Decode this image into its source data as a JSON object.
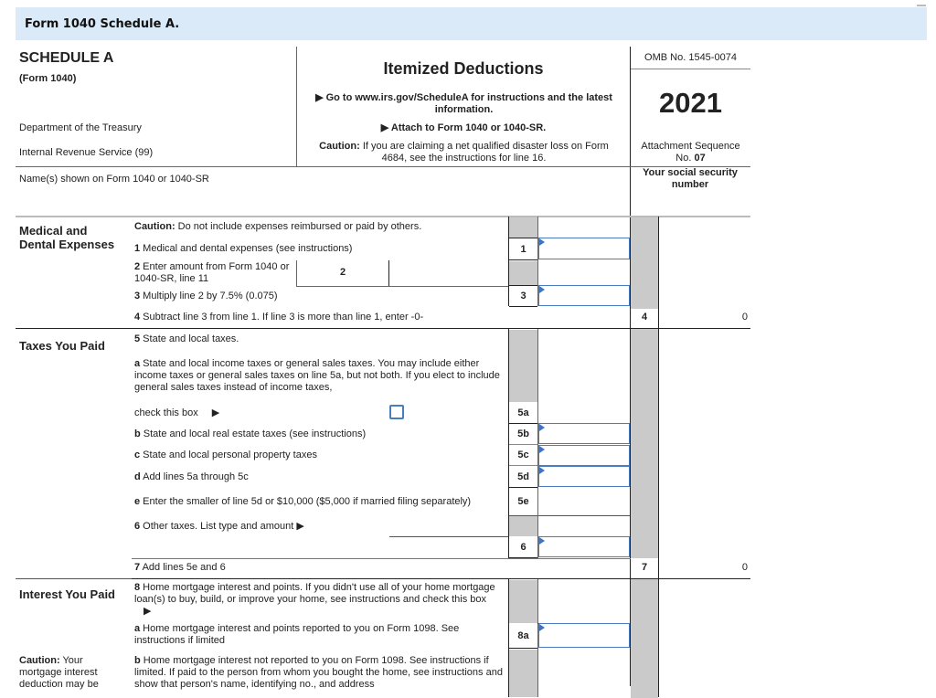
{
  "page": {
    "title": "Form 1040 Schedule A."
  },
  "header": {
    "schedule": "SCHEDULE A",
    "form": "(Form 1040)",
    "department": "Department of the Treasury",
    "irs": "Internal Revenue Service (99)",
    "main_title": "Itemized Deductions",
    "goto_text": "Go to www.irs.gov/ScheduleA for instructions and the latest information.",
    "attach_text": "Attach to Form 1040 or 1040-SR.",
    "caution_label": "Caution:",
    "caution_text": " If you are claiming a net qualified disaster loss on Form 4684, see the instructions for line 16.",
    "omb": "OMB No. 1545-0074",
    "year": "2021",
    "attachment_seq_label": "Attachment Sequence",
    "attachment_no_label": "No.",
    "attachment_no": "07",
    "name_label": "Name(s) shown on Form 1040 or 1040-SR",
    "ssn_label": "Your social security number",
    "arrow_icon": "▶"
  },
  "sections": {
    "medical": {
      "heading": "Medical and Dental Expenses",
      "caution_label": "Caution:",
      "caution_text": " Do not include expenses reimbursed or paid by others.",
      "lines": {
        "l1": {
          "num": "1",
          "text": " Medical and dental expenses (see instructions)",
          "box": "1",
          "value": ""
        },
        "l2": {
          "num": "2",
          "text": " Enter amount from Form 1040 or 1040-SR, line 11",
          "box": "2",
          "value": ""
        },
        "l3": {
          "num": "3",
          "text": " Multiply line 2 by 7.5% (0.075)",
          "box": "3",
          "value": ""
        },
        "l4": {
          "num": "4",
          "text": " Subtract line 3 from line 1. If line 3 is more than line 1, enter -0-",
          "box": "4",
          "value": "0"
        }
      }
    },
    "taxes": {
      "heading": "Taxes You Paid",
      "lines": {
        "l5": {
          "num": "5",
          "text": " State and local taxes."
        },
        "l5a": {
          "num": "a",
          "text": " State and local income taxes or general sales taxes. You may include either income taxes or general sales taxes on line 5a, but not both. If you elect to include general sales taxes instead of income taxes,",
          "check_text": "check this box",
          "box": "5a",
          "checked": false
        },
        "l5b": {
          "num": "b",
          "text": " State and local real estate taxes (see instructions)",
          "box": "5b",
          "value": ""
        },
        "l5c": {
          "num": "c",
          "text": " State and local personal property taxes",
          "box": "5c",
          "value": ""
        },
        "l5d": {
          "num": "d",
          "text": " Add lines 5a through 5c",
          "box": "5d",
          "value": ""
        },
        "l5e": {
          "num": "e",
          "text": " Enter the smaller of line 5d or $10,000 ($5,000 if married filing separately)",
          "box": "5e",
          "value": ""
        },
        "l6": {
          "num": "6",
          "text": " Other taxes. List type and amount",
          "box": "6",
          "value": "",
          "type_value": ""
        },
        "l7": {
          "num": "7",
          "text": " Add lines 5e and 6",
          "box": "7",
          "value": "0"
        }
      }
    },
    "interest": {
      "heading": "Interest You Paid",
      "caution_label": "Caution:",
      "caution_text": " Your mortgage interest deduction may be",
      "lines": {
        "l8": {
          "num": "8",
          "text": " Home mortgage interest and points. If you didn't use all of your home mortgage loan(s) to buy, build, or improve your home, see instructions and check this box"
        },
        "l8a": {
          "num": "a",
          "text": " Home mortgage interest and points reported to you on Form 1098. See instructions if limited",
          "box": "8a",
          "value": ""
        },
        "l8b": {
          "num": "b",
          "text": " Home mortgage interest not reported to you on Form 1098. See instructions if limited. If paid to the person from whom you bought the home, see instructions and show that person's name, identifying no., and address"
        }
      }
    }
  }
}
